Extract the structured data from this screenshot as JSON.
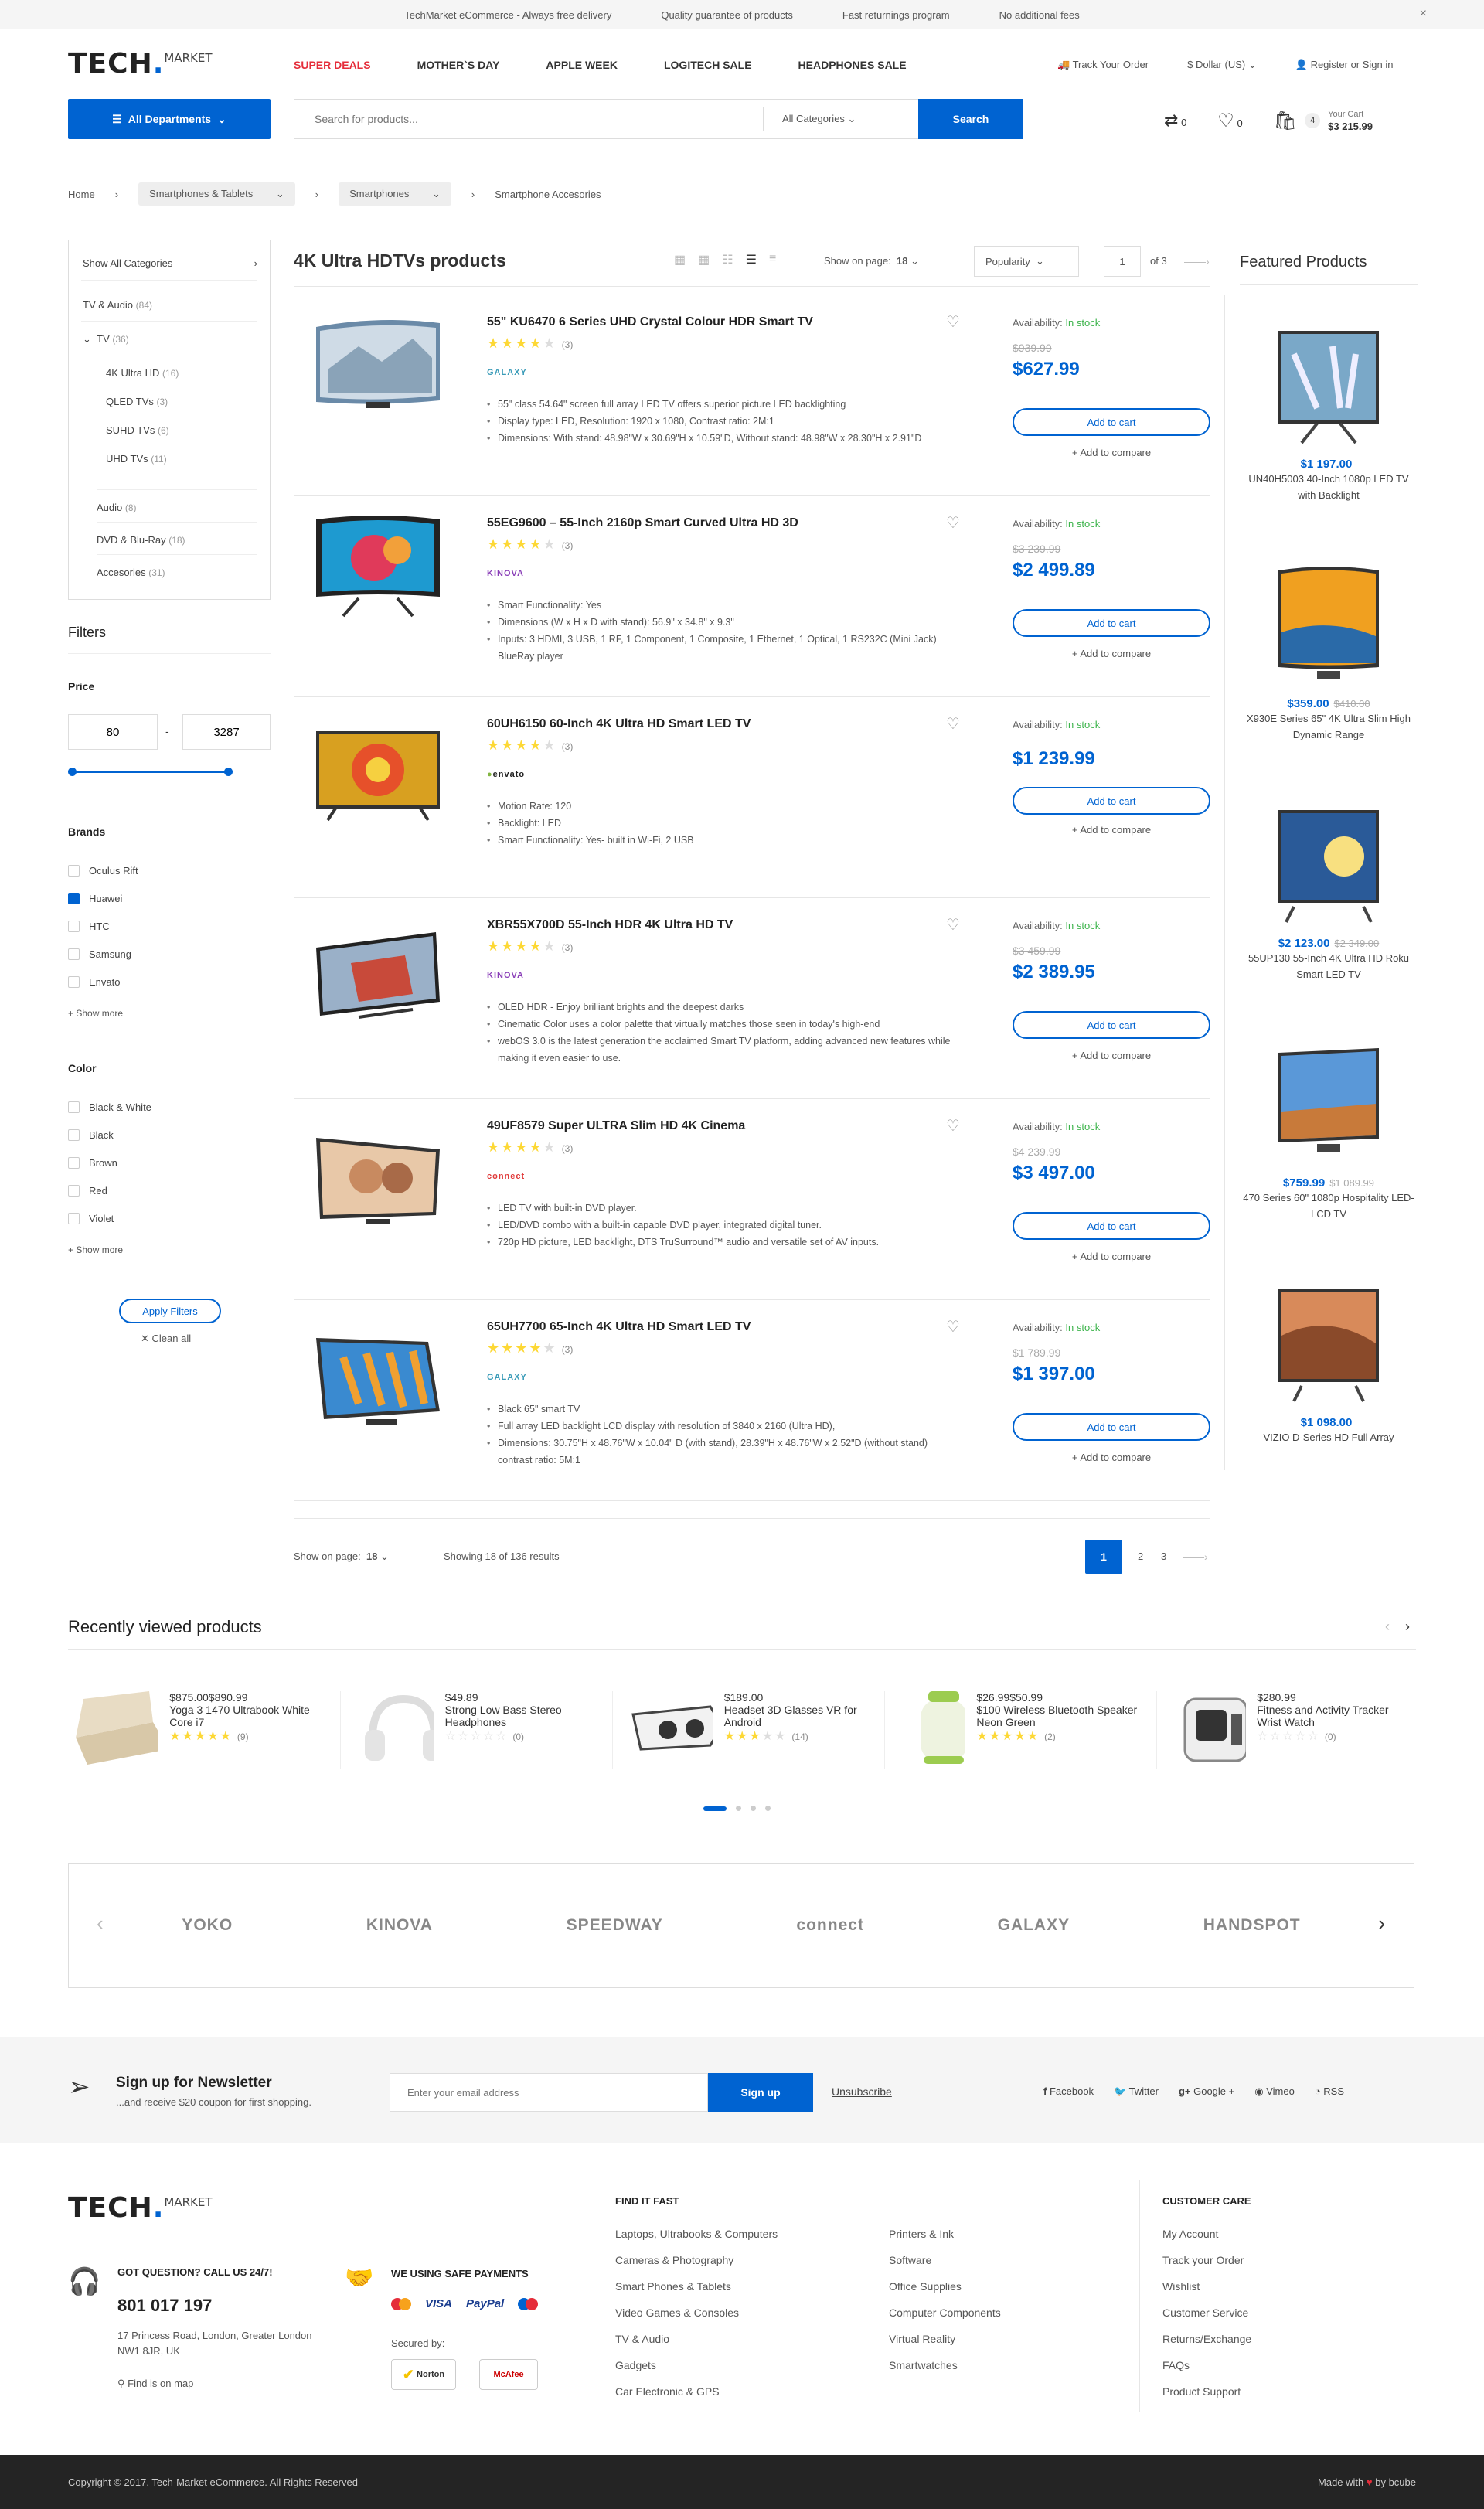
{
  "topbar": {
    "items": [
      "TechMarket eCommerce - Always free delivery",
      "Quality guarantee of products",
      "Fast returnings program",
      "No additional fees"
    ],
    "close": "×"
  },
  "header": {
    "logo_main": "TECH",
    "logo_sup": "MARKET",
    "nav": [
      "SUPER DEALS",
      "MOTHER`S DAY",
      "APPLE WEEK",
      "LOGITECH SALE",
      "HEADPHONES SALE"
    ],
    "track": "Track Your Order",
    "currency": "Dollar (US)",
    "account": "Register or Sign in",
    "departments": "All Departments",
    "search_placeholder": "Search for products...",
    "search_category": "All Categories",
    "search_btn": "Search",
    "compare_count": "0",
    "wish_count": "0",
    "cart_count": "4",
    "cart_label": "Your Cart",
    "cart_total": "$3 215.99"
  },
  "breadcrumb": [
    "Home",
    "Smartphones & Tablets",
    "Smartphones",
    "Smartphone Accesories"
  ],
  "sidebar": {
    "show_all": "Show All Categories",
    "categories": [
      {
        "label": "TV & Audio",
        "count": "(84)"
      },
      {
        "label": "TV",
        "count": "(36)"
      },
      {
        "label": "4K Ultra HD",
        "count": "(16)"
      },
      {
        "label": "QLED TVs",
        "count": "(3)"
      },
      {
        "label": "SUHD TVs",
        "count": "(6)"
      },
      {
        "label": "UHD TVs",
        "count": "(11)"
      },
      {
        "label": "Audio",
        "count": "(8)"
      },
      {
        "label": "DVD & Blu-Ray",
        "count": "(18)"
      },
      {
        "label": "Accesories",
        "count": "(31)"
      }
    ],
    "filters_title": "Filters",
    "price_title": "Price",
    "price_min": "80",
    "price_max": "3287",
    "brands_title": "Brands",
    "brands": [
      "Oculus Rift",
      "Huawei",
      "HTC",
      "Samsung",
      "Envato"
    ],
    "brands_checked": [
      false,
      true,
      false,
      false,
      false
    ],
    "show_more": "+ Show more",
    "color_title": "Color",
    "colors": [
      "Black & White",
      "Black",
      "Brown",
      "Red",
      "Violet"
    ],
    "apply": "Apply Filters",
    "clean": "Clean all"
  },
  "listing": {
    "title": "4K Ultra HDTVs products",
    "show_label": "Show on page:",
    "show_value": "18",
    "sort": "Popularity",
    "page": "1",
    "of": "of 3"
  },
  "products": [
    {
      "name": "55\" KU6470 6 Series UHD Crystal Colour HDR Smart TV",
      "rating": 4,
      "reviews": "(3)",
      "brand": "GALAXY",
      "bullets": [
        "55\" class 54.64\" screen full array LED TV offers superior picture LED backlighting",
        "Display type: LED, Resolution: 1920 x 1080, Contrast ratio: 2M:1",
        "Dimensions: With stand: 48.98\"W x 30.69\"H x 10.59\"D, Without stand: 48.98\"W x 28.30\"H x 2.91\"D"
      ],
      "avail_label": "Availability:",
      "avail": "In stock",
      "old": "$939.99",
      "price": "$627.99",
      "cart": "Add to cart",
      "compare": "+ Add to compare"
    },
    {
      "name": "55EG9600 – 55-Inch 2160p Smart Curved Ultra HD 3D",
      "rating": 4,
      "reviews": "(3)",
      "brand": "KINOVA",
      "bullets": [
        "Smart Functionality: Yes",
        "Dimensions (W x H x D with stand): 56.9\" x 34.8\" x 9.3\"",
        "Inputs: 3 HDMI, 3 USB, 1 RF, 1 Component, 1 Composite, 1 Ethernet, 1 Optical, 1 RS232C (Mini Jack) BlueRay player"
      ],
      "avail_label": "Availability:",
      "avail": "In stock",
      "old": "$3 239.99",
      "price": "$2 499.89",
      "cart": "Add to cart",
      "compare": "+ Add to compare"
    },
    {
      "name": "60UH6150 60-Inch 4K Ultra HD Smart LED TV",
      "rating": 4,
      "reviews": "(3)",
      "brand": "envato",
      "bullets": [
        "Motion Rate: 120",
        "Backlight: LED",
        "Smart Functionality: Yes- built in Wi-Fi, 2 USB"
      ],
      "avail_label": "Availability:",
      "avail": "In stock",
      "old": "",
      "price": "$1 239.99",
      "cart": "Add to cart",
      "compare": "+ Add to compare"
    },
    {
      "name": "XBR55X700D 55-Inch HDR 4K Ultra HD TV",
      "rating": 4,
      "reviews": "(3)",
      "brand": "KINOVA",
      "bullets": [
        "OLED HDR - Enjoy brilliant brights and the deepest darks",
        "Cinematic Color uses a color palette that virtually matches those seen in today's high-end",
        "webOS 3.0 is the latest generation the acclaimed Smart TV platform, adding advanced new features while making it even easier to use."
      ],
      "avail_label": "Availability:",
      "avail": "In stock",
      "old": "$3 459.99",
      "price": "$2 389.95",
      "cart": "Add to cart",
      "compare": "+ Add to compare"
    },
    {
      "name": "49UF8579  Super ULTRA Slim HD 4K Cinema",
      "rating": 4,
      "reviews": "(3)",
      "brand": "connect",
      "bullets": [
        "LED TV with built-in DVD player.",
        "LED/DVD combo with a built-in capable DVD player, integrated digital tuner.",
        "720p HD picture, LED backlight, DTS TruSurround™ audio and versatile set of AV inputs."
      ],
      "avail_label": "Availability:",
      "avail": "In stock",
      "old": "$4 239.99",
      "price": "$3 497.00",
      "cart": "Add to cart",
      "compare": "+ Add to compare"
    },
    {
      "name": "65UH7700 65-Inch 4K Ultra HD Smart LED TV",
      "rating": 4,
      "reviews": "(3)",
      "brand": "GALAXY",
      "bullets": [
        "Black 65\" smart TV",
        "Full array LED backlight LCD display with resolution of 3840 x 2160 (Ultra HD),",
        "Dimensions: 30.75\"H x 48.76\"W x 10.04\" D (with stand), 28.39\"H x 48.76\"W x 2.52\"D (without stand) contrast ratio: 5M:1"
      ],
      "avail_label": "Availability:",
      "avail": "In stock",
      "old": "$1 789.99",
      "price": "$1 397.00",
      "cart": "Add to cart",
      "compare": "+ Add to compare"
    }
  ],
  "pagination": {
    "show_label": "Show on page:",
    "show_value": "18",
    "showing": "Showing 18 of 136 results",
    "pages": [
      "1",
      "2",
      "3"
    ]
  },
  "featured": {
    "title": "Featured Products",
    "items": [
      {
        "price": "$1 197.00",
        "old": "",
        "name": "UN40H5003 40-Inch 1080p LED TV with Backlight"
      },
      {
        "price": "$359.00",
        "old": "$410.00",
        "name": "X930E Series 65\" 4K Ultra Slim High Dynamic Range"
      },
      {
        "price": "$2 123.00",
        "old": "$2 349.00",
        "name": "55UP130 55-Inch 4K Ultra HD Roku Smart LED TV"
      },
      {
        "price": "$759.99",
        "old": "$1 089.99",
        "name": "470 Series 60\" 1080p Hospitality LED-LCD TV"
      },
      {
        "price": "$1 098.00",
        "old": "",
        "name": "VIZIO D-Series HD Full Array"
      }
    ]
  },
  "recent": {
    "title": "Recently viewed products",
    "items": [
      {
        "price": "$875.00",
        "old": "$890.99",
        "name": "Yoga 3 1470 Ultrabook White – Core i7",
        "rating": 5,
        "reviews": "(9)"
      },
      {
        "price": "$49.89",
        "old": "",
        "name": "Strong Low Bass Stereo Headphones",
        "rating": 0,
        "reviews": "(0)"
      },
      {
        "price": "$189.00",
        "old": "",
        "name": "Headset 3D Glasses VR for Android",
        "rating": 3,
        "reviews": "(14)"
      },
      {
        "price": "$26.99",
        "old": "$50.99",
        "name": "$100 Wireless Bluetooth Speaker – Neon Green",
        "rating": 5,
        "reviews": "(2)"
      },
      {
        "price": "$280.99",
        "old": "",
        "name": "Fitness and Activity Tracker Wrist Watch",
        "rating": 0,
        "reviews": "(0)"
      }
    ]
  },
  "brands_strip": [
    "YOKO",
    "KINOVA",
    "SPEEDWAY",
    "connect",
    "GALAXY",
    "HANDSPOT"
  ],
  "newsletter": {
    "title": "Sign up for Newsletter",
    "sub": "...and receive $20 coupon for first shopping.",
    "placeholder": "Enter your email address",
    "btn": "Sign up",
    "unsub": "Unsubscribe",
    "social": [
      "Facebook",
      "Twitter",
      "Google +",
      "Vimeo",
      "RSS"
    ]
  },
  "footer": {
    "question": "GOT QUESTION? CALL US 24/7!",
    "phone": "801 017 197",
    "address": "17 Princess Road, London, Greater London NW1 8JR, UK",
    "map": "Find is on map",
    "safe": "WE USING SAFE PAYMENTS",
    "payments": [
      "VISA",
      "PayPal"
    ],
    "secured": "Secured by:",
    "find_title": "FIND IT FAST",
    "find_col1": [
      "Laptops, Ultrabooks & Computers",
      "Cameras & Photography",
      "Smart Phones & Tablets",
      "Video Games & Consoles",
      "TV & Audio",
      "Gadgets",
      "Car Electronic & GPS"
    ],
    "find_col2": [
      "Printers & Ink",
      "Software",
      "Office Supplies",
      "Computer Components",
      "Virtual Reality",
      "Smartwatches"
    ],
    "care_title": "CUSTOMER CARE",
    "care": [
      "My Account",
      "Track your Order",
      "Wishlist",
      "Customer Service",
      "Returns/Exchange",
      "FAQs",
      "Product Support"
    ],
    "copyright": "Copyright © 2017, Tech-Market eCommerce. All Rights Reserved",
    "made": "Made with",
    "by": "by bcube"
  },
  "colors": {
    "accent": "#0063d1",
    "sale": "#e52d3a",
    "instock": "#3bb34a",
    "star": "#fdd835"
  }
}
